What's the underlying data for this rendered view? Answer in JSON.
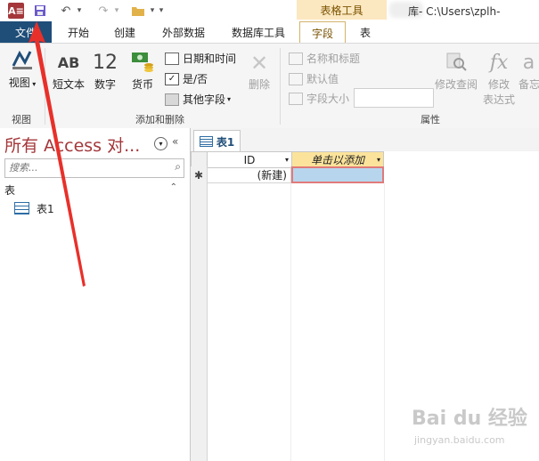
{
  "titlebar": {
    "app_icon": "A≡",
    "contextual_tab_group": "表格工具",
    "window_title": "库- C:\\Users\\zplh-"
  },
  "tabs": [
    {
      "label": "文件"
    },
    {
      "label": "开始"
    },
    {
      "label": "创建"
    },
    {
      "label": "外部数据"
    },
    {
      "label": "数据库工具"
    },
    {
      "label": "字段"
    },
    {
      "label": "表"
    }
  ],
  "ribbon": {
    "view": {
      "label": "视图",
      "group": "视图"
    },
    "add_delete": {
      "group": "添加和删除",
      "short_text": {
        "glyph": "AB",
        "label": "短文本"
      },
      "number": {
        "glyph": "12",
        "label": "数字"
      },
      "currency": {
        "label": "货币"
      },
      "date_time": "日期和时间",
      "yes_no": "是/否",
      "more_fields": "其他字段",
      "delete": "删除"
    },
    "properties": {
      "group": "属性",
      "name_caption": "名称和标题",
      "default_value": "默认值",
      "field_size": "字段大小",
      "modify_lookups": "修改查阅",
      "modify_expression_1": "修改",
      "modify_expression_2": "表达式",
      "fx_glyph": "fx",
      "memo": "备忘"
    }
  },
  "nav": {
    "title": "所有 Access 对...",
    "search_placeholder": "搜索...",
    "section": "表",
    "items": [
      {
        "label": "表1"
      }
    ]
  },
  "document": {
    "tab_label": "表1",
    "columns": [
      {
        "label": "ID"
      },
      {
        "label": "单击以添加"
      }
    ],
    "new_row_marker": "✱",
    "new_row_value": "(新建)"
  },
  "watermark": {
    "text": "Bai du 经验",
    "sub": "jingyan.baidu.com"
  },
  "colors": {
    "file_tab": "#1f4e79",
    "access_red": "#a4373a",
    "contextual": "#fbe7c0",
    "header_yellow": "#fbe39b",
    "selected_cell": "#b7d6ee"
  }
}
